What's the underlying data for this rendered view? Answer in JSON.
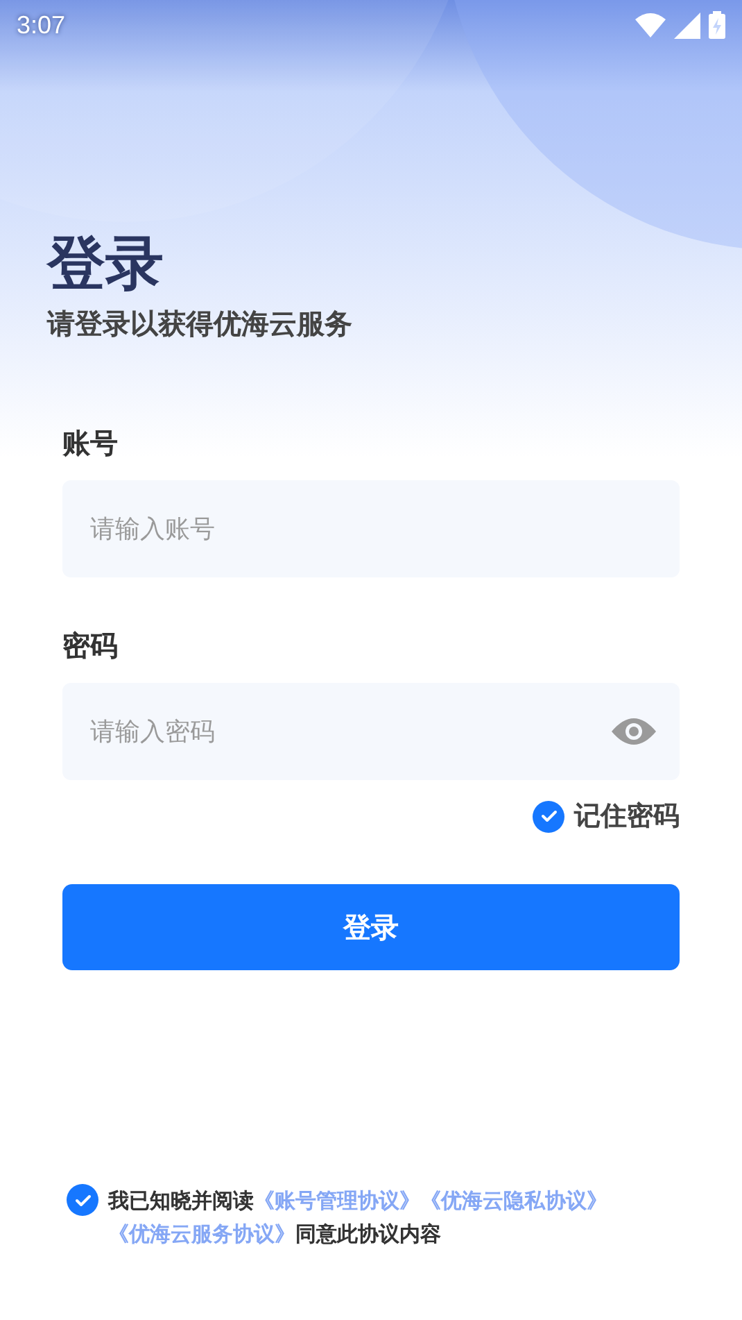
{
  "status_bar": {
    "time": "3:07"
  },
  "header": {
    "title": "登录",
    "subtitle": "请登录以获得优海云服务"
  },
  "fields": [
    {
      "label": "账号",
      "placeholder": "请输入账号",
      "kind": "text"
    },
    {
      "label": "密码",
      "placeholder": "请输入密码",
      "kind": "password"
    }
  ],
  "remember": {
    "label": "记住密码",
    "checked": true
  },
  "login_button": "登录",
  "agreement": {
    "checked": true,
    "parts": [
      {
        "kind": "text",
        "text": "我已知晓并阅读"
      },
      {
        "kind": "link",
        "text": "《账号管理协议》"
      },
      {
        "kind": "link",
        "text": "《优海云隐私协议》"
      },
      {
        "kind": "link",
        "text": "《优海云服务协议》"
      },
      {
        "kind": "text",
        "text": "同意此协议内容"
      }
    ]
  }
}
